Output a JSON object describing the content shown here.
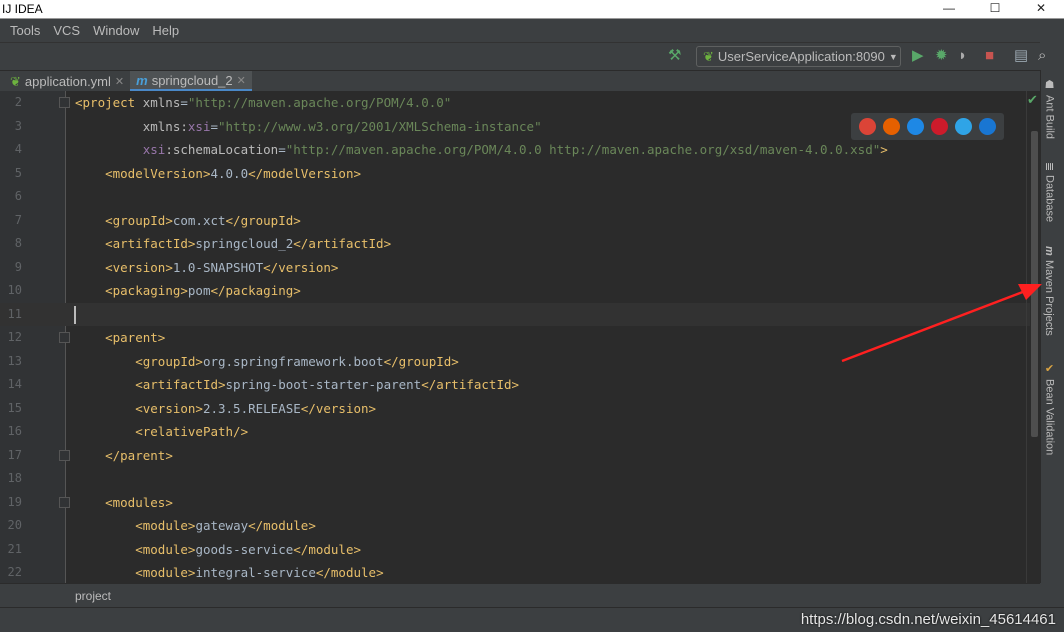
{
  "window": {
    "title": "IJ IDEA",
    "controls": [
      "—",
      "☐",
      "✕"
    ]
  },
  "menu": [
    {
      "u": "T",
      "rest": "ools"
    },
    {
      "u": "",
      "rest": "VC",
      "u2": "S"
    },
    {
      "u": "W",
      "rest": "indow"
    },
    {
      "u": "H",
      "rest": "elp"
    }
  ],
  "menu_labels": [
    "Tools",
    "VCS",
    "Window",
    "Help"
  ],
  "toolbar": {
    "run_config": "UserServiceApplication:8090",
    "icons": [
      "build-hammer-icon",
      "run-icon",
      "debug-icon",
      "coverage-icon",
      "stop-icon",
      "project-structure-icon",
      "search-icon"
    ]
  },
  "tabs": [
    {
      "label": "application.yml",
      "icon": "spring-leaf-icon",
      "active": false
    },
    {
      "label": "springcloud_2",
      "icon": "maven-m-icon",
      "active": true
    }
  ],
  "editor": {
    "current_line": 11,
    "lines": [
      {
        "n": "2",
        "fold": true,
        "tokens": [
          [
            "t",
            "<project "
          ],
          [
            "an",
            "xmlns"
          ],
          [
            "x",
            "="
          ],
          [
            "av",
            "\"http://maven.apache.org/POM/4.0.0\""
          ]
        ]
      },
      {
        "n": "3",
        "tokens": [
          [
            "x",
            "         "
          ],
          [
            "an",
            "xmlns:"
          ],
          [
            "ns",
            "xsi"
          ],
          [
            "x",
            "="
          ],
          [
            "av",
            "\"http://www.w3.org/2001/XMLSchema-instance\""
          ]
        ]
      },
      {
        "n": "4",
        "tokens": [
          [
            "x",
            "         "
          ],
          [
            "ns",
            "xsi"
          ],
          [
            "an",
            ":schemaLocation"
          ],
          [
            "x",
            "="
          ],
          [
            "av",
            "\"http://maven.apache.org/POM/4.0.0 http://maven.apache.org/xsd/maven-4.0.0.xsd\""
          ],
          [
            "t",
            ">"
          ]
        ]
      },
      {
        "n": "5",
        "tokens": [
          [
            "x",
            "    "
          ],
          [
            "t",
            "<modelVersion>"
          ],
          [
            "x",
            "4.0.0"
          ],
          [
            "t",
            "</modelVersion>"
          ]
        ]
      },
      {
        "n": "6",
        "tokens": []
      },
      {
        "n": "7",
        "tokens": [
          [
            "x",
            "    "
          ],
          [
            "t",
            "<groupId>"
          ],
          [
            "x",
            "com.xct"
          ],
          [
            "t",
            "</groupId>"
          ]
        ]
      },
      {
        "n": "8",
        "tokens": [
          [
            "x",
            "    "
          ],
          [
            "t",
            "<artifactId>"
          ],
          [
            "x",
            "springcloud_2"
          ],
          [
            "t",
            "</artifactId>"
          ]
        ]
      },
      {
        "n": "9",
        "tokens": [
          [
            "x",
            "    "
          ],
          [
            "t",
            "<version>"
          ],
          [
            "x",
            "1.0-SNAPSHOT"
          ],
          [
            "t",
            "</version>"
          ]
        ]
      },
      {
        "n": "10",
        "tokens": [
          [
            "x",
            "    "
          ],
          [
            "t",
            "<packaging>"
          ],
          [
            "x",
            "pom"
          ],
          [
            "t",
            "</packaging>"
          ]
        ]
      },
      {
        "n": "11",
        "tokens": []
      },
      {
        "n": "12",
        "fold": true,
        "tokens": [
          [
            "x",
            "    "
          ],
          [
            "t",
            "<parent>"
          ]
        ]
      },
      {
        "n": "13",
        "tokens": [
          [
            "x",
            "        "
          ],
          [
            "t",
            "<groupId>"
          ],
          [
            "x",
            "org.springframework.boot"
          ],
          [
            "t",
            "</groupId>"
          ]
        ]
      },
      {
        "n": "14",
        "tokens": [
          [
            "x",
            "        "
          ],
          [
            "t",
            "<artifactId>"
          ],
          [
            "x",
            "spring-boot-starter-parent"
          ],
          [
            "t",
            "</artifactId>"
          ]
        ]
      },
      {
        "n": "15",
        "tokens": [
          [
            "x",
            "        "
          ],
          [
            "t",
            "<version>"
          ],
          [
            "x",
            "2.3.5.RELEASE"
          ],
          [
            "t",
            "</version>"
          ]
        ]
      },
      {
        "n": "16",
        "tokens": [
          [
            "x",
            "        "
          ],
          [
            "t",
            "<relativePath/>"
          ]
        ]
      },
      {
        "n": "17",
        "fold": true,
        "tokens": [
          [
            "x",
            "    "
          ],
          [
            "t",
            "</parent>"
          ]
        ]
      },
      {
        "n": "18",
        "tokens": []
      },
      {
        "n": "19",
        "fold": true,
        "tokens": [
          [
            "x",
            "    "
          ],
          [
            "t",
            "<modules>"
          ]
        ]
      },
      {
        "n": "20",
        "tokens": [
          [
            "x",
            "        "
          ],
          [
            "t",
            "<module>"
          ],
          [
            "x",
            "gateway"
          ],
          [
            "t",
            "</module>"
          ]
        ]
      },
      {
        "n": "21",
        "tokens": [
          [
            "x",
            "        "
          ],
          [
            "t",
            "<module>"
          ],
          [
            "x",
            "goods-service"
          ],
          [
            "t",
            "</module>"
          ]
        ]
      },
      {
        "n": "22",
        "tokens": [
          [
            "x",
            "        "
          ],
          [
            "t",
            "<module>"
          ],
          [
            "x",
            "integral-service"
          ],
          [
            "t",
            "</module>"
          ]
        ]
      }
    ]
  },
  "browsers": [
    {
      "name": "chrome-icon",
      "color": "#db4437"
    },
    {
      "name": "firefox-icon",
      "color": "#e66000"
    },
    {
      "name": "safari-icon",
      "color": "#1e88e5"
    },
    {
      "name": "opera-icon",
      "color": "#cc1b2b"
    },
    {
      "name": "ie-icon",
      "color": "#2fa4e7"
    },
    {
      "name": "edge-icon",
      "color": "#1976d2"
    }
  ],
  "sidebar": [
    {
      "label": "Ant Build",
      "icon": "ant-icon"
    },
    {
      "label": "Database",
      "icon": "database-icon"
    },
    {
      "label": "Maven Projects",
      "icon": "maven-m-icon"
    },
    {
      "label": "Bean Validation",
      "icon": "bean-validation-icon"
    }
  ],
  "breadcrumb": "project",
  "watermark": "https://blog.csdn.net/weixin_45614461",
  "colors": {
    "editor_bg": "#2b2b2b",
    "tag": "#e8bf6a",
    "attr_value": "#6a8759",
    "accent": "#4a88c7",
    "annotation_arrow": "#ff2020"
  }
}
